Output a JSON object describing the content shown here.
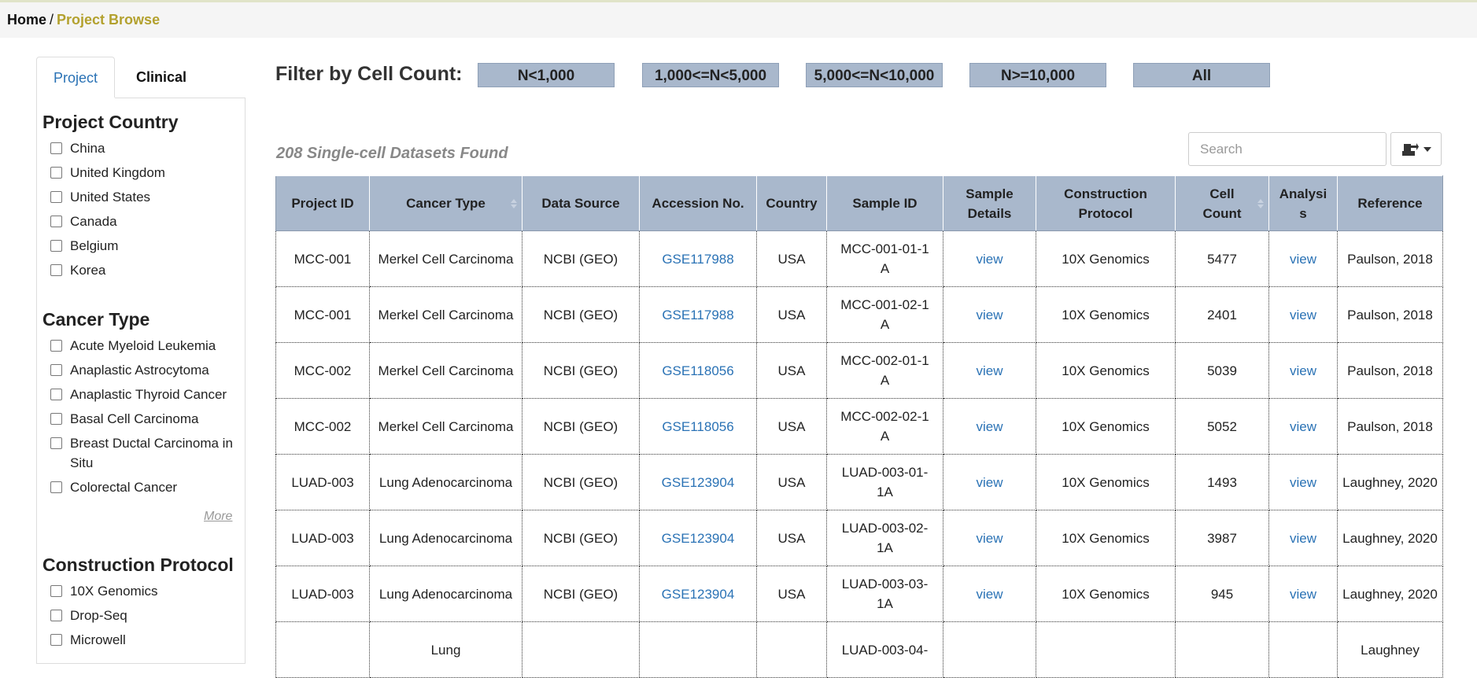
{
  "breadcrumb": {
    "home": "Home",
    "separator": "/",
    "current": "Project Browse"
  },
  "sidebar": {
    "tabs": [
      {
        "label": "Project",
        "active": true
      },
      {
        "label": "Clinical",
        "active": false
      }
    ],
    "groups": [
      {
        "title": "Project Country",
        "options": [
          "China",
          "United Kingdom",
          "United States",
          "Canada",
          "Belgium",
          "Korea"
        ]
      },
      {
        "title": "Cancer Type",
        "options": [
          "Acute Myeloid Leukemia",
          "Anaplastic Astrocytoma",
          "Anaplastic Thyroid Cancer",
          "Basal Cell Carcinoma",
          "Breast Ductal Carcinoma in Situ",
          "Colorectal Cancer"
        ],
        "more": "More"
      },
      {
        "title": "Construction Protocol",
        "options": [
          "10X Genomics",
          "Drop-Seq",
          "Microwell"
        ]
      }
    ]
  },
  "filter": {
    "label": "Filter by Cell Count:",
    "buttons": [
      "N<1,000",
      "1,000<=N<5,000",
      "5,000<=N<10,000",
      "N>=10,000",
      "All"
    ]
  },
  "results": {
    "summary": "208 Single-cell Datasets Found"
  },
  "search": {
    "placeholder": "Search",
    "value": ""
  },
  "export": {
    "icon": "export-icon"
  },
  "colors": {
    "header_bg": "#a9b8cc",
    "link": "#2a72b5",
    "breadcrumb_current": "#b3a12e"
  },
  "table": {
    "headers": [
      "Project ID",
      "Cancer Type",
      "Data Source",
      "Accession No.",
      "Country",
      "Sample ID",
      "Sample Details",
      "Construction Protocol",
      "Cell Count",
      "Analysis",
      "Reference"
    ],
    "rows": [
      [
        "MCC-001",
        "Merkel Cell Carcinoma",
        "NCBI (GEO)",
        "GSE117988",
        "USA",
        "MCC-001-01-1A",
        "view",
        "10X Genomics",
        "5477",
        "view",
        "Paulson, 2018"
      ],
      [
        "MCC-001",
        "Merkel Cell Carcinoma",
        "NCBI (GEO)",
        "GSE117988",
        "USA",
        "MCC-001-02-1A",
        "view",
        "10X Genomics",
        "2401",
        "view",
        "Paulson, 2018"
      ],
      [
        "MCC-002",
        "Merkel Cell Carcinoma",
        "NCBI (GEO)",
        "GSE118056",
        "USA",
        "MCC-002-01-1A",
        "view",
        "10X Genomics",
        "5039",
        "view",
        "Paulson, 2018"
      ],
      [
        "MCC-002",
        "Merkel Cell Carcinoma",
        "NCBI (GEO)",
        "GSE118056",
        "USA",
        "MCC-002-02-1A",
        "view",
        "10X Genomics",
        "5052",
        "view",
        "Paulson, 2018"
      ],
      [
        "LUAD-003",
        "Lung Adenocarcinoma",
        "NCBI (GEO)",
        "GSE123904",
        "USA",
        "LUAD-003-01-1A",
        "view",
        "10X Genomics",
        "1493",
        "view",
        "Laughney, 2020"
      ],
      [
        "LUAD-003",
        "Lung Adenocarcinoma",
        "NCBI (GEO)",
        "GSE123904",
        "USA",
        "LUAD-003-02-1A",
        "view",
        "10X Genomics",
        "3987",
        "view",
        "Laughney, 2020"
      ],
      [
        "LUAD-003",
        "Lung Adenocarcinoma",
        "NCBI (GEO)",
        "GSE123904",
        "USA",
        "LUAD-003-03-1A",
        "view",
        "10X Genomics",
        "945",
        "view",
        "Laughney, 2020"
      ],
      [
        "",
        "Lung",
        "",
        "",
        "",
        "LUAD-003-04-",
        "",
        "",
        "",
        "",
        "Laughney"
      ]
    ]
  }
}
